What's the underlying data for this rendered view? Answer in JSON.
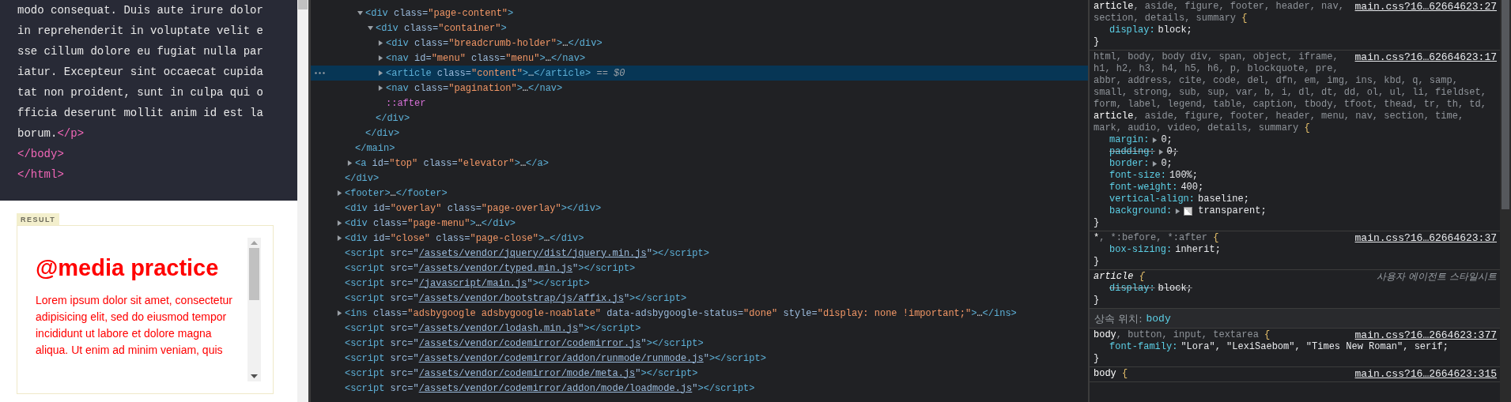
{
  "source_code": {
    "lines": [
      [
        {
          "kind": "text",
          "text": "modo consequat. Duis aute irure dolor"
        }
      ],
      [
        {
          "kind": "text",
          "text": "in reprehenderit in voluptate velit e"
        }
      ],
      [
        {
          "kind": "text",
          "text": "sse cillum dolore eu fugiat nulla par"
        }
      ],
      [
        {
          "kind": "text",
          "text": "iatur. Excepteur sint occaecat cupida"
        }
      ],
      [
        {
          "kind": "text",
          "text": "tat non proident, sunt in culpa qui o"
        }
      ],
      [
        {
          "kind": "text",
          "text": "fficia deserunt mollit anim id est la"
        }
      ],
      [
        {
          "kind": "text",
          "text": "borum."
        },
        {
          "kind": "tag",
          "text": "</p>"
        }
      ],
      [
        {
          "kind": "tag",
          "text": "</body>"
        }
      ],
      [
        {
          "kind": "tag",
          "text": "</html>"
        }
      ]
    ]
  },
  "result": {
    "label": "RESULT",
    "heading": "@media practice",
    "paragraph": "Lorem ipsum dolor sit amet, consectetur adipisicing elit, sed do eiusmod tempor incididunt ut labore et dolore magna aliqua. Ut enim ad minim veniam, quis"
  },
  "elements": {
    "nodes": [
      {
        "children": [
          {
            "children": [
              {
                "open": [
                  {
                    "kind": "tag",
                    "text": "<div"
                  },
                  {
                    "kind": "attr",
                    "text": " class="
                  },
                  {
                    "kind": "value",
                    "text": "\"page-content\""
                  },
                  {
                    "kind": "tag",
                    "text": ">"
                  }
                ],
                "expanded": true,
                "selected": false,
                "children": [
                  {
                    "open": [
                      {
                        "kind": "tag",
                        "text": "<div"
                      },
                      {
                        "kind": "attr",
                        "text": " class="
                      },
                      {
                        "kind": "value",
                        "text": "\"container\""
                      },
                      {
                        "kind": "tag",
                        "text": ">"
                      }
                    ],
                    "expanded": true,
                    "selected": false,
                    "children": [
                      {
                        "open": [
                          {
                            "kind": "tag",
                            "text": "<div"
                          },
                          {
                            "kind": "attr",
                            "text": " class="
                          },
                          {
                            "kind": "value",
                            "text": "\"breadcrumb-holder\""
                          },
                          {
                            "kind": "tag",
                            "text": ">"
                          },
                          {
                            "kind": "plain",
                            "text": "…"
                          },
                          {
                            "kind": "tag",
                            "text": "</div>"
                          }
                        ],
                        "expanded": false,
                        "selected": false
                      },
                      {
                        "open": [
                          {
                            "kind": "tag",
                            "text": "<nav"
                          },
                          {
                            "kind": "attr",
                            "text": " id="
                          },
                          {
                            "kind": "value",
                            "text": "\"menu\""
                          },
                          {
                            "kind": "attr",
                            "text": " class="
                          },
                          {
                            "kind": "value",
                            "text": "\"menu\""
                          },
                          {
                            "kind": "tag",
                            "text": ">"
                          },
                          {
                            "kind": "plain",
                            "text": "…"
                          },
                          {
                            "kind": "tag",
                            "text": "</nav>"
                          }
                        ],
                        "expanded": false,
                        "selected": false
                      },
                      {
                        "open": [
                          {
                            "kind": "tag",
                            "text": "<article"
                          },
                          {
                            "kind": "attr",
                            "text": " class="
                          },
                          {
                            "kind": "value",
                            "text": "\"content\""
                          },
                          {
                            "kind": "tag",
                            "text": ">"
                          },
                          {
                            "kind": "plain",
                            "text": "…"
                          },
                          {
                            "kind": "tag",
                            "text": "</article>"
                          },
                          {
                            "kind": "hint",
                            "text": " == $0"
                          }
                        ],
                        "expanded": false,
                        "selected": true
                      },
                      {
                        "open": [
                          {
                            "kind": "tag",
                            "text": "<nav"
                          },
                          {
                            "kind": "attr",
                            "text": " class="
                          },
                          {
                            "kind": "value",
                            "text": "\"pagination\""
                          },
                          {
                            "kind": "tag",
                            "text": ">"
                          },
                          {
                            "kind": "plain",
                            "text": "…"
                          },
                          {
                            "kind": "tag",
                            "text": "</nav>"
                          }
                        ],
                        "expanded": false,
                        "selected": false
                      },
                      {
                        "open": [
                          {
                            "kind": "pseudo",
                            "text": "::after"
                          }
                        ],
                        "selected": false
                      }
                    ],
                    "close": [
                      {
                        "kind": "tag",
                        "text": "</div>"
                      }
                    ]
                  }
                ],
                "close": [
                  {
                    "kind": "tag",
                    "text": "</div>"
                  }
                ]
              }
            ],
            "close": [
              {
                "kind": "tag",
                "text": "</main>"
              }
            ]
          },
          {
            "open": [
              {
                "kind": "tag",
                "text": "<a"
              },
              {
                "kind": "attr",
                "text": " id="
              },
              {
                "kind": "value",
                "text": "\"top\""
              },
              {
                "kind": "attr",
                "text": " class="
              },
              {
                "kind": "value",
                "text": "\"elevator\""
              },
              {
                "kind": "tag",
                "text": ">"
              },
              {
                "kind": "plain",
                "text": "…"
              },
              {
                "kind": "tag",
                "text": "</a>"
              }
            ],
            "expanded": false,
            "selected": false
          }
        ],
        "close": [
          {
            "kind": "tag",
            "text": "</div>"
          }
        ]
      },
      {
        "open": [
          {
            "kind": "tag",
            "text": "<footer>"
          },
          {
            "kind": "plain",
            "text": "…"
          },
          {
            "kind": "tag",
            "text": "</footer>"
          }
        ],
        "expanded": false,
        "selected": false
      },
      {
        "open": [
          {
            "kind": "tag",
            "text": "<div"
          },
          {
            "kind": "attr",
            "text": " id="
          },
          {
            "kind": "value",
            "text": "\"overlay\""
          },
          {
            "kind": "attr",
            "text": " class="
          },
          {
            "kind": "value",
            "text": "\"page-overlay\""
          },
          {
            "kind": "tag",
            "text": "></div>"
          }
        ],
        "selected": false
      },
      {
        "open": [
          {
            "kind": "tag",
            "text": "<div"
          },
          {
            "kind": "attr",
            "text": " class="
          },
          {
            "kind": "value",
            "text": "\"page-menu\""
          },
          {
            "kind": "tag",
            "text": ">"
          },
          {
            "kind": "plain",
            "text": "…"
          },
          {
            "kind": "tag",
            "text": "</div>"
          }
        ],
        "expanded": false,
        "selected": false
      },
      {
        "open": [
          {
            "kind": "tag",
            "text": "<div"
          },
          {
            "kind": "attr",
            "text": " id="
          },
          {
            "kind": "value",
            "text": "\"close\""
          },
          {
            "kind": "attr",
            "text": " class="
          },
          {
            "kind": "value",
            "text": "\"page-close\""
          },
          {
            "kind": "tag",
            "text": ">"
          },
          {
            "kind": "plain",
            "text": "…"
          },
          {
            "kind": "tag",
            "text": "</div>"
          }
        ],
        "expanded": false,
        "selected": false
      },
      {
        "open": [
          {
            "kind": "tag",
            "text": "<script"
          },
          {
            "kind": "attr",
            "text": " src=\""
          },
          {
            "kind": "link",
            "text": "/assets/vendor/jquery/dist/jquery.min.js"
          },
          {
            "kind": "attr",
            "text": "\""
          },
          {
            "kind": "tag",
            "text": "></script>"
          }
        ],
        "selected": false
      },
      {
        "open": [
          {
            "kind": "tag",
            "text": "<script"
          },
          {
            "kind": "attr",
            "text": " src=\""
          },
          {
            "kind": "link",
            "text": "/assets/vendor/typed.min.js"
          },
          {
            "kind": "attr",
            "text": "\""
          },
          {
            "kind": "tag",
            "text": "></script>"
          }
        ],
        "selected": false
      },
      {
        "open": [
          {
            "kind": "tag",
            "text": "<script"
          },
          {
            "kind": "attr",
            "text": " src=\""
          },
          {
            "kind": "link",
            "text": "/javascript/main.js"
          },
          {
            "kind": "attr",
            "text": "\""
          },
          {
            "kind": "tag",
            "text": "></script>"
          }
        ],
        "selected": false
      },
      {
        "open": [
          {
            "kind": "tag",
            "text": "<script"
          },
          {
            "kind": "attr",
            "text": " src=\""
          },
          {
            "kind": "link",
            "text": "/assets/vendor/bootstrap/js/affix.js"
          },
          {
            "kind": "attr",
            "text": "\""
          },
          {
            "kind": "tag",
            "text": "></script>"
          }
        ],
        "selected": false
      },
      {
        "open": [
          {
            "kind": "tag",
            "text": "<ins"
          },
          {
            "kind": "attr",
            "text": " class="
          },
          {
            "kind": "value",
            "text": "\"adsbygoogle adsbygoogle-noablate\""
          },
          {
            "kind": "attr",
            "text": " data-adsbygoogle-status="
          },
          {
            "kind": "value",
            "text": "\"done\""
          },
          {
            "kind": "attr",
            "text": " style="
          },
          {
            "kind": "value",
            "text": "\"display: none !important;\""
          },
          {
            "kind": "tag",
            "text": ">"
          },
          {
            "kind": "plain",
            "text": "…"
          },
          {
            "kind": "tag",
            "text": "</ins>"
          }
        ],
        "expanded": false,
        "selected": false
      },
      {
        "open": [
          {
            "kind": "tag",
            "text": "<script"
          },
          {
            "kind": "attr",
            "text": " src=\""
          },
          {
            "kind": "link",
            "text": "/assets/vendor/lodash.min.js"
          },
          {
            "kind": "attr",
            "text": "\""
          },
          {
            "kind": "tag",
            "text": "></script>"
          }
        ],
        "selected": false
      },
      {
        "open": [
          {
            "kind": "tag",
            "text": "<script"
          },
          {
            "kind": "attr",
            "text": " src=\""
          },
          {
            "kind": "link",
            "text": "/assets/vendor/codemirror/codemirror.js"
          },
          {
            "kind": "attr",
            "text": "\""
          },
          {
            "kind": "tag",
            "text": "></script>"
          }
        ],
        "selected": false
      },
      {
        "open": [
          {
            "kind": "tag",
            "text": "<script"
          },
          {
            "kind": "attr",
            "text": " src=\""
          },
          {
            "kind": "link",
            "text": "/assets/vendor/codemirror/addon/runmode/runmode.js"
          },
          {
            "kind": "attr",
            "text": "\""
          },
          {
            "kind": "tag",
            "text": "></script>"
          }
        ],
        "selected": false
      },
      {
        "open": [
          {
            "kind": "tag",
            "text": "<script"
          },
          {
            "kind": "attr",
            "text": " src=\""
          },
          {
            "kind": "link",
            "text": "/assets/vendor/codemirror/mode/meta.js"
          },
          {
            "kind": "attr",
            "text": "\""
          },
          {
            "kind": "tag",
            "text": "></script>"
          }
        ],
        "selected": false
      },
      {
        "open": [
          {
            "kind": "tag",
            "text": "<script"
          },
          {
            "kind": "attr",
            "text": " src=\""
          },
          {
            "kind": "link",
            "text": "/assets/vendor/codemirror/addon/mode/loadmode.js"
          },
          {
            "kind": "attr",
            "text": "\""
          },
          {
            "kind": "tag",
            "text": "></script>"
          }
        ],
        "selected": false
      }
    ]
  },
  "styles": {
    "rules": [
      {
        "kind": "author",
        "source": "main.css?16…62664623:27",
        "selector": [
          [
            {
              "text": "article",
              "matched": true
            },
            {
              "text": ", aside, figure, footer, header, nav,",
              "matched": false
            }
          ],
          [
            {
              "text": "section, details, summary",
              "matched": false
            }
          ]
        ],
        "open": "{",
        "close": "}",
        "properties": [
          {
            "name": "display:",
            "value": "block;",
            "overridden": false,
            "expandable": false,
            "swatch": false
          }
        ]
      },
      {
        "kind": "author",
        "source": "main.css?16…62664623:17",
        "selector": [
          [
            {
              "text": "html, body, body div, span, object, iframe,",
              "matched": false
            }
          ],
          [
            {
              "text": "h1, h2, h3, h4, h5, h6, p, blockquote, pre,",
              "matched": false
            }
          ],
          [
            {
              "text": "abbr, address, cite, code, del, dfn, em, img, ins, kbd, q, samp,",
              "matched": false
            }
          ],
          [
            {
              "text": "small, strong, sub, sup, var, b, i, dl, dt, dd, ol, ul, li, fieldset,",
              "matched": false
            }
          ],
          [
            {
              "text": "form, label, legend, table, caption, tbody, tfoot, thead, tr, th, td,",
              "matched": false
            }
          ],
          [
            {
              "text": "article",
              "matched": true
            },
            {
              "text": ", aside, figure, footer, header, menu, nav, section, time,",
              "matched": false
            }
          ],
          [
            {
              "text": "mark, audio, video, details, summary",
              "matched": false
            }
          ]
        ],
        "open": "{",
        "close": "}",
        "properties": [
          {
            "name": "margin:",
            "value": "0;",
            "overridden": false,
            "expandable": true,
            "swatch": false
          },
          {
            "name": "padding:",
            "value": "0;",
            "overridden": true,
            "expandable": true,
            "swatch": false
          },
          {
            "name": "border:",
            "value": "0;",
            "overridden": false,
            "expandable": true,
            "swatch": false
          },
          {
            "name": "font-size:",
            "value": "100%;",
            "overridden": false,
            "expandable": false,
            "swatch": false
          },
          {
            "name": "font-weight:",
            "value": "400;",
            "overridden": false,
            "expandable": false,
            "swatch": false
          },
          {
            "name": "vertical-align:",
            "value": "baseline;",
            "overridden": false,
            "expandable": false,
            "swatch": false
          },
          {
            "name": "background:",
            "value": "transparent;",
            "overridden": false,
            "expandable": true,
            "swatch": true
          }
        ]
      },
      {
        "kind": "author",
        "source": "main.css?16…62664623:37",
        "selector": [
          [
            {
              "text": "*",
              "matched": true
            },
            {
              "text": ", *:before, *:after",
              "matched": false
            }
          ]
        ],
        "open": "{",
        "close": "}",
        "properties": [
          {
            "name": "box-sizing:",
            "value": "inherit;",
            "overridden": false,
            "expandable": false,
            "swatch": false
          }
        ]
      },
      {
        "kind": "user-agent",
        "source": "사용자 에이전트 스타일시트",
        "selector": [
          [
            {
              "text": "article",
              "matched": true
            }
          ]
        ],
        "open": "{",
        "close": "}",
        "properties": [
          {
            "name": "display:",
            "value": "block;",
            "overridden": true,
            "expandable": false,
            "swatch": false
          }
        ]
      },
      {
        "kind": "inherited",
        "label": "상속 위치:",
        "target": "body"
      },
      {
        "kind": "author",
        "source": "main.css?16…2664623:377",
        "selector": [
          [
            {
              "text": "body",
              "matched": true
            },
            {
              "text": ", button, input, textarea",
              "matched": false
            }
          ]
        ],
        "open": "{",
        "close": "}",
        "properties": [
          {
            "name": "font-family:",
            "value": "\"Lora\", \"LexiSaebom\", \"Times New Roman\", serif;",
            "overridden": false,
            "expandable": false,
            "swatch": false
          }
        ]
      },
      {
        "kind": "author",
        "source": "main.css?16…2664623:315",
        "selector": [
          [
            {
              "text": "body",
              "matched": true
            }
          ]
        ],
        "open": "{"
      }
    ]
  }
}
